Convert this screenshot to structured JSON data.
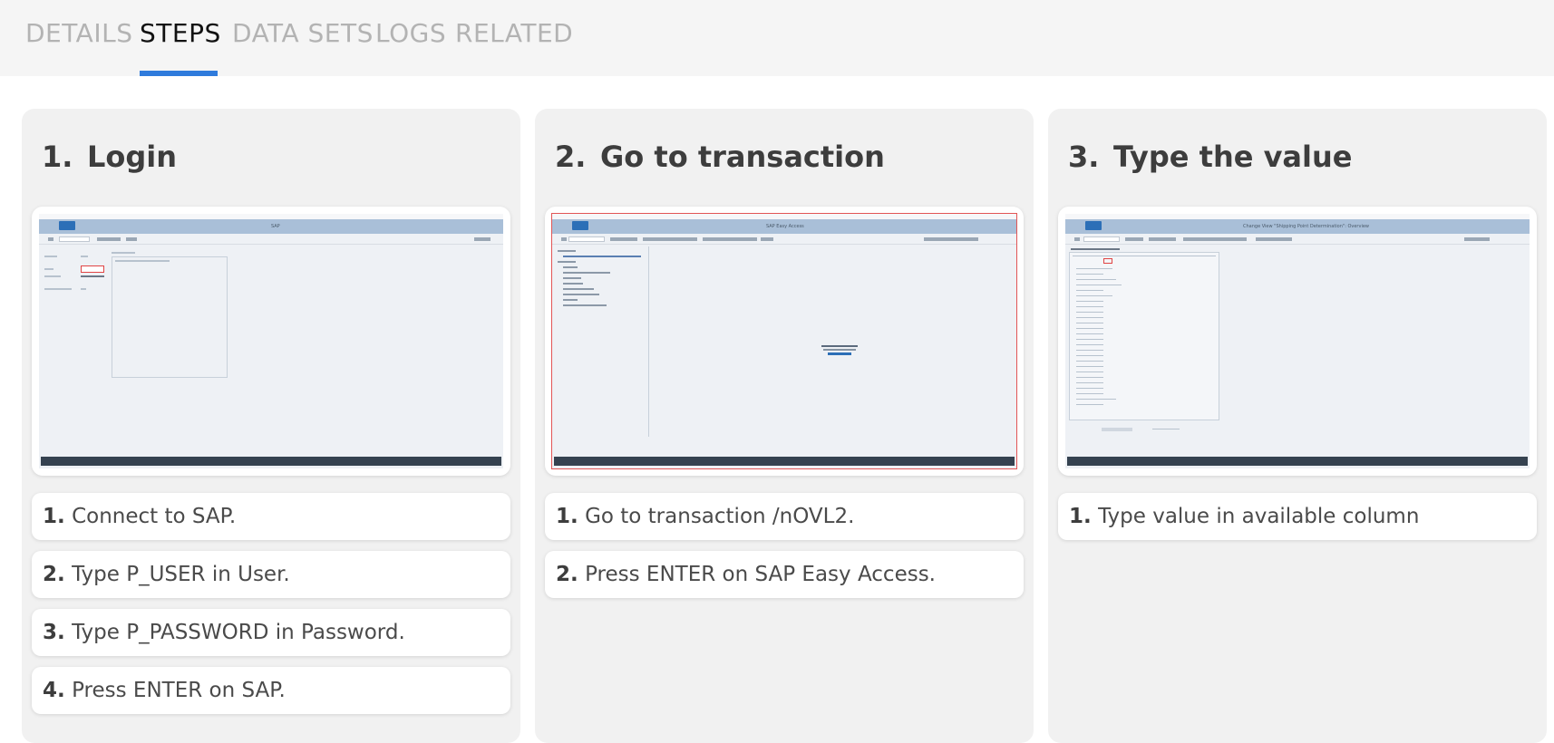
{
  "tabs": [
    {
      "label": "DETAILS",
      "active": false
    },
    {
      "label": "STEPS",
      "active": true
    },
    {
      "label": "DATA SETS",
      "active": false
    },
    {
      "label": "LOGS",
      "active": false
    },
    {
      "label": "RELATED",
      "active": false
    }
  ],
  "accent_color": "#2f7bdc",
  "columns": [
    {
      "number": "1.",
      "title": "Login",
      "screenshot": {
        "window_title": "SAP"
      },
      "steps": [
        {
          "num": "1.",
          "text": "Connect to SAP."
        },
        {
          "num": "2.",
          "text": "Type P_USER in User."
        },
        {
          "num": "3.",
          "text": "Type P_PASSWORD in Password."
        },
        {
          "num": "4.",
          "text": "Press ENTER on SAP."
        }
      ]
    },
    {
      "number": "2.",
      "title": "Go to transaction",
      "screenshot": {
        "window_title": "SAP Easy Access"
      },
      "steps": [
        {
          "num": "1.",
          "text": "Go to transaction /nOVL2."
        },
        {
          "num": "2.",
          "text": "Press ENTER on SAP Easy Access."
        }
      ]
    },
    {
      "number": "3.",
      "title": "Type the value",
      "screenshot": {
        "window_title": "Change View \"Shipping Point Determination\": Overview"
      },
      "steps": [
        {
          "num": "1.",
          "text": "Type value in available column"
        }
      ]
    }
  ]
}
